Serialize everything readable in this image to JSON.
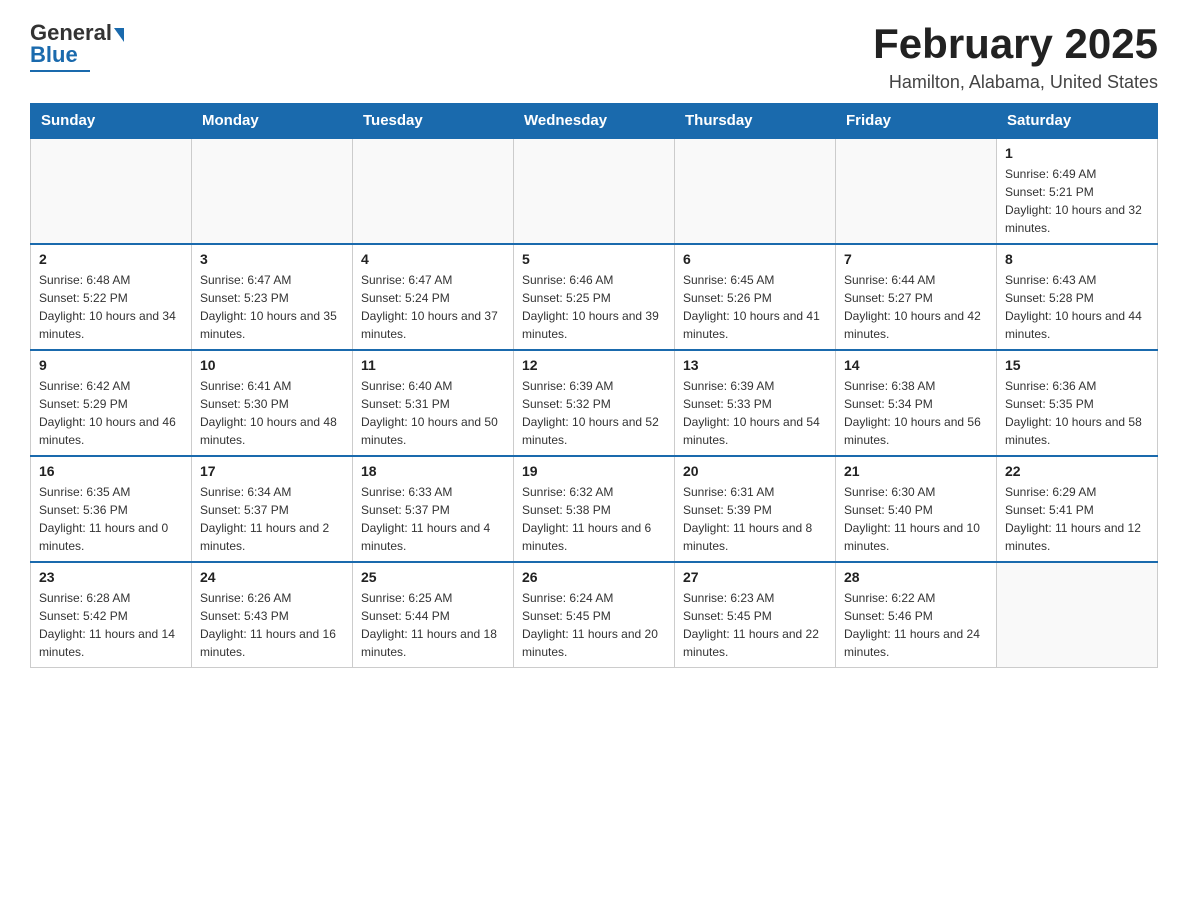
{
  "header": {
    "logo_general": "General",
    "logo_blue": "Blue",
    "month_title": "February 2025",
    "location": "Hamilton, Alabama, United States"
  },
  "weekdays": [
    "Sunday",
    "Monday",
    "Tuesday",
    "Wednesday",
    "Thursday",
    "Friday",
    "Saturday"
  ],
  "weeks": [
    [
      {
        "day": "",
        "info": ""
      },
      {
        "day": "",
        "info": ""
      },
      {
        "day": "",
        "info": ""
      },
      {
        "day": "",
        "info": ""
      },
      {
        "day": "",
        "info": ""
      },
      {
        "day": "",
        "info": ""
      },
      {
        "day": "1",
        "info": "Sunrise: 6:49 AM\nSunset: 5:21 PM\nDaylight: 10 hours and 32 minutes."
      }
    ],
    [
      {
        "day": "2",
        "info": "Sunrise: 6:48 AM\nSunset: 5:22 PM\nDaylight: 10 hours and 34 minutes."
      },
      {
        "day": "3",
        "info": "Sunrise: 6:47 AM\nSunset: 5:23 PM\nDaylight: 10 hours and 35 minutes."
      },
      {
        "day": "4",
        "info": "Sunrise: 6:47 AM\nSunset: 5:24 PM\nDaylight: 10 hours and 37 minutes."
      },
      {
        "day": "5",
        "info": "Sunrise: 6:46 AM\nSunset: 5:25 PM\nDaylight: 10 hours and 39 minutes."
      },
      {
        "day": "6",
        "info": "Sunrise: 6:45 AM\nSunset: 5:26 PM\nDaylight: 10 hours and 41 minutes."
      },
      {
        "day": "7",
        "info": "Sunrise: 6:44 AM\nSunset: 5:27 PM\nDaylight: 10 hours and 42 minutes."
      },
      {
        "day": "8",
        "info": "Sunrise: 6:43 AM\nSunset: 5:28 PM\nDaylight: 10 hours and 44 minutes."
      }
    ],
    [
      {
        "day": "9",
        "info": "Sunrise: 6:42 AM\nSunset: 5:29 PM\nDaylight: 10 hours and 46 minutes."
      },
      {
        "day": "10",
        "info": "Sunrise: 6:41 AM\nSunset: 5:30 PM\nDaylight: 10 hours and 48 minutes."
      },
      {
        "day": "11",
        "info": "Sunrise: 6:40 AM\nSunset: 5:31 PM\nDaylight: 10 hours and 50 minutes."
      },
      {
        "day": "12",
        "info": "Sunrise: 6:39 AM\nSunset: 5:32 PM\nDaylight: 10 hours and 52 minutes."
      },
      {
        "day": "13",
        "info": "Sunrise: 6:39 AM\nSunset: 5:33 PM\nDaylight: 10 hours and 54 minutes."
      },
      {
        "day": "14",
        "info": "Sunrise: 6:38 AM\nSunset: 5:34 PM\nDaylight: 10 hours and 56 minutes."
      },
      {
        "day": "15",
        "info": "Sunrise: 6:36 AM\nSunset: 5:35 PM\nDaylight: 10 hours and 58 minutes."
      }
    ],
    [
      {
        "day": "16",
        "info": "Sunrise: 6:35 AM\nSunset: 5:36 PM\nDaylight: 11 hours and 0 minutes."
      },
      {
        "day": "17",
        "info": "Sunrise: 6:34 AM\nSunset: 5:37 PM\nDaylight: 11 hours and 2 minutes."
      },
      {
        "day": "18",
        "info": "Sunrise: 6:33 AM\nSunset: 5:37 PM\nDaylight: 11 hours and 4 minutes."
      },
      {
        "day": "19",
        "info": "Sunrise: 6:32 AM\nSunset: 5:38 PM\nDaylight: 11 hours and 6 minutes."
      },
      {
        "day": "20",
        "info": "Sunrise: 6:31 AM\nSunset: 5:39 PM\nDaylight: 11 hours and 8 minutes."
      },
      {
        "day": "21",
        "info": "Sunrise: 6:30 AM\nSunset: 5:40 PM\nDaylight: 11 hours and 10 minutes."
      },
      {
        "day": "22",
        "info": "Sunrise: 6:29 AM\nSunset: 5:41 PM\nDaylight: 11 hours and 12 minutes."
      }
    ],
    [
      {
        "day": "23",
        "info": "Sunrise: 6:28 AM\nSunset: 5:42 PM\nDaylight: 11 hours and 14 minutes."
      },
      {
        "day": "24",
        "info": "Sunrise: 6:26 AM\nSunset: 5:43 PM\nDaylight: 11 hours and 16 minutes."
      },
      {
        "day": "25",
        "info": "Sunrise: 6:25 AM\nSunset: 5:44 PM\nDaylight: 11 hours and 18 minutes."
      },
      {
        "day": "26",
        "info": "Sunrise: 6:24 AM\nSunset: 5:45 PM\nDaylight: 11 hours and 20 minutes."
      },
      {
        "day": "27",
        "info": "Sunrise: 6:23 AM\nSunset: 5:45 PM\nDaylight: 11 hours and 22 minutes."
      },
      {
        "day": "28",
        "info": "Sunrise: 6:22 AM\nSunset: 5:46 PM\nDaylight: 11 hours and 24 minutes."
      },
      {
        "day": "",
        "info": ""
      }
    ]
  ]
}
